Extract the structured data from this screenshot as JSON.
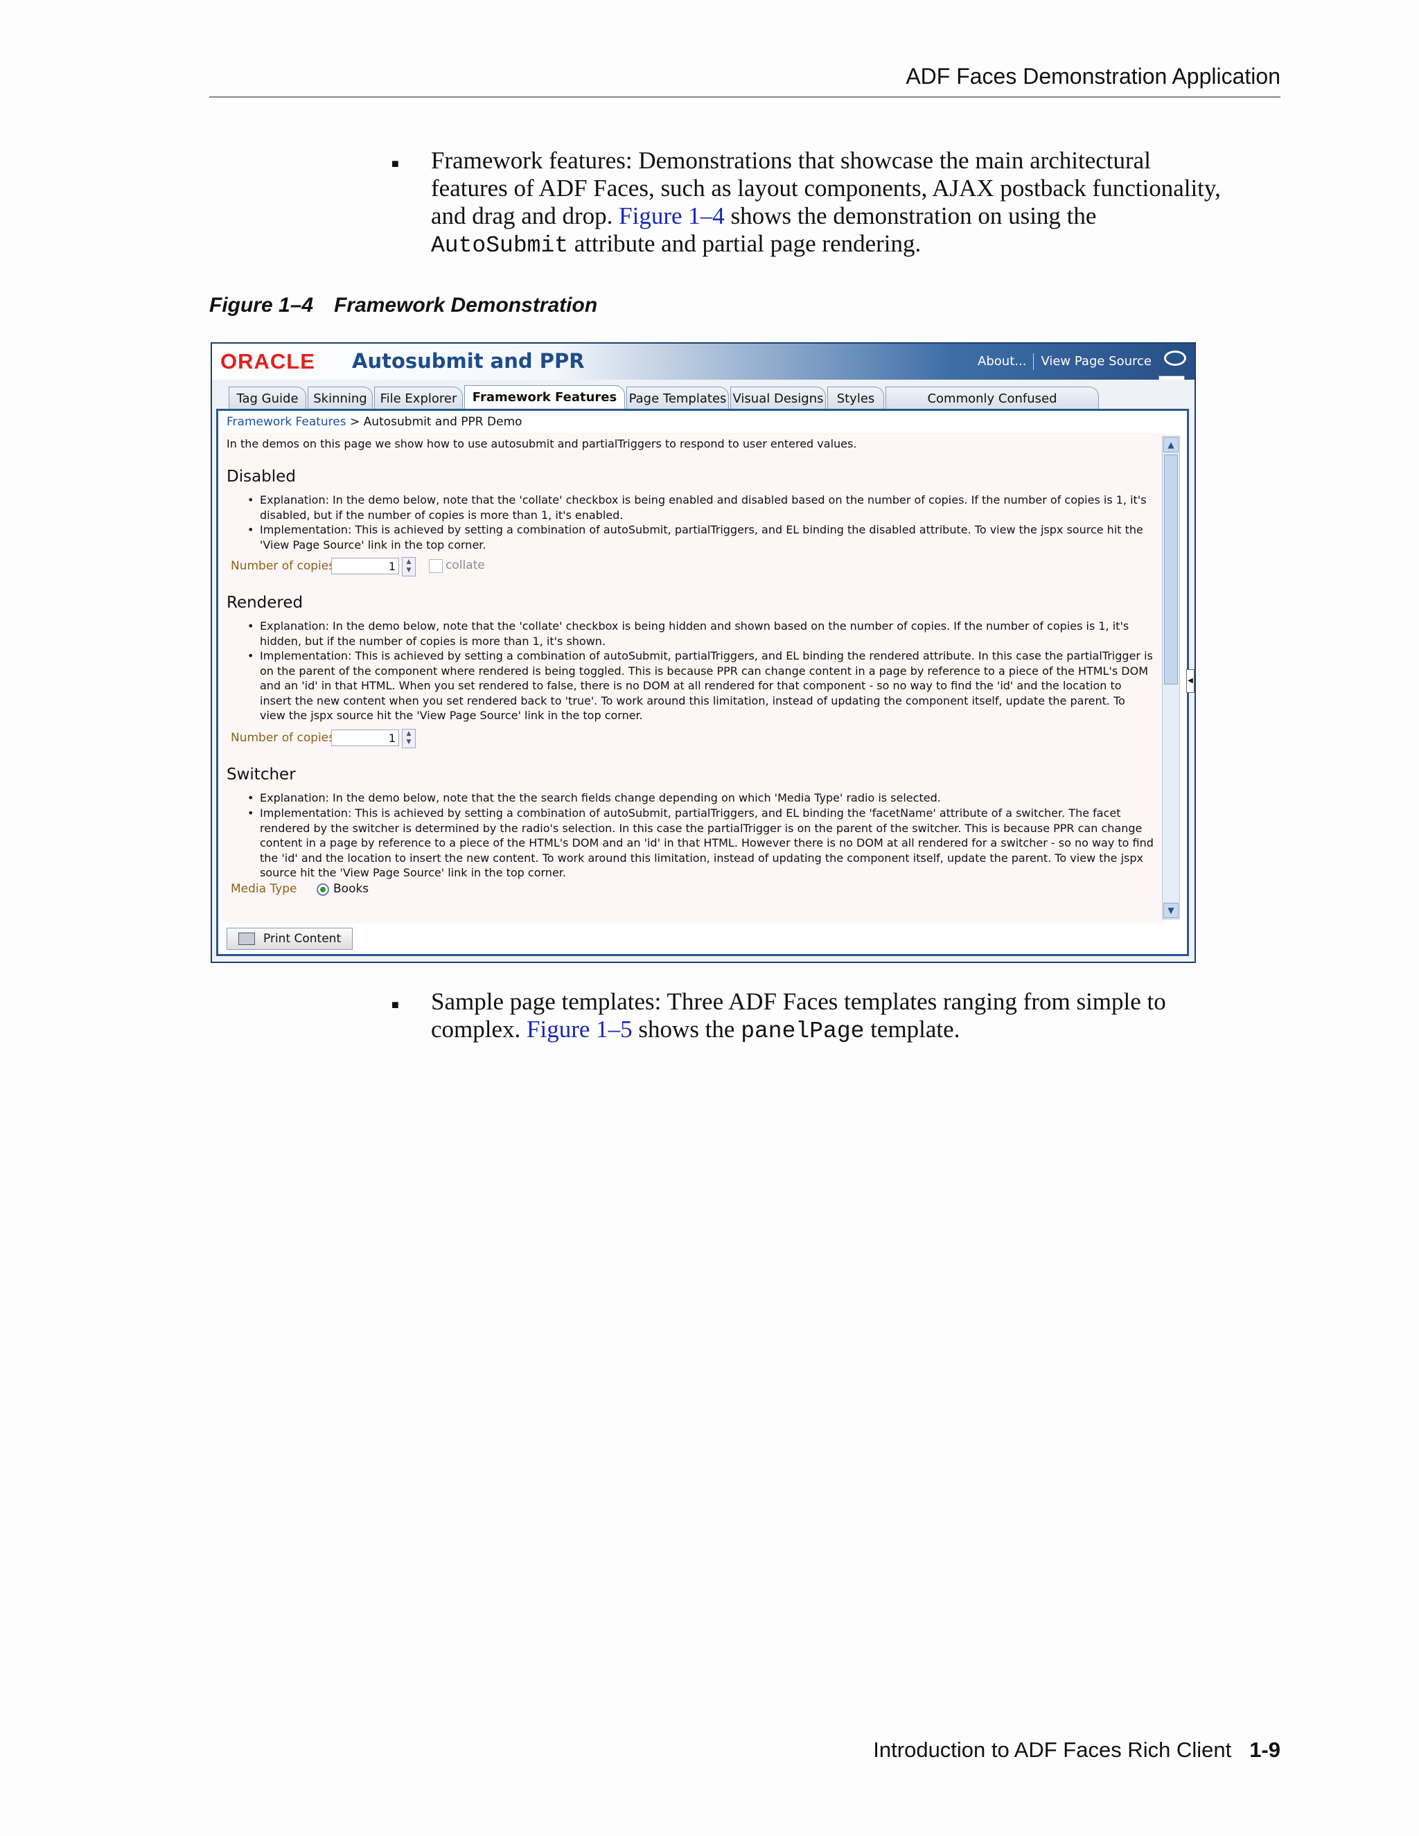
{
  "header": {
    "running_title": "ADF Faces Demonstration Application"
  },
  "items": [
    {
      "line1": "Framework features: Demonstrations that showcase the main architectural",
      "line2": "features of ADF Faces, such as layout components, AJAX postback functionality,",
      "line3_pre": "and drag and drop. ",
      "line3_link": "Figure 1–4",
      "line3_post": " shows the demonstration on using the",
      "line4_code": "AutoSubmit",
      "line4_post": " attribute and partial page rendering."
    },
    {
      "line1": "Sample page templates: Three ADF Faces templates ranging from simple to",
      "line2_pre": "complex. ",
      "line2_link": "Figure 1–5",
      "line2_mid": " shows the ",
      "line2_code": "panelPage",
      "line2_post": " template."
    }
  ],
  "figure": {
    "number": "Figure 1–4",
    "title": "Framework Demonstration"
  },
  "screenshot": {
    "logo": "ORACLE",
    "title": "Autosubmit and PPR",
    "links": [
      "About...",
      "View Page Source"
    ],
    "tabs": [
      "Tag Guide",
      "Skinning",
      "File Explorer",
      "Framework Features",
      "Page Templates",
      "Visual Designs",
      "Styles",
      "Commonly Confused Components"
    ],
    "active_tab": "Framework Features",
    "breadcrumb": {
      "link": "Framework Features",
      "sep": " > ",
      "current": "Autosubmit and PPR Demo"
    },
    "intro": "In the demos on this page we show how to use autosubmit and partialTriggers to respond to user entered values.",
    "sections": [
      {
        "heading": "Disabled",
        "bullets": [
          "Explanation: In the demo below, note that the 'collate' checkbox is being enabled and disabled based on the number of copies. If the number of copies is 1, it's disabled, but if the number of copies is more than 1, it's enabled.",
          "Implementation: This is achieved by setting a combination of autoSubmit, partialTriggers, and EL binding the disabled attribute. To view the jspx source hit the 'View Page Source' link in the top corner."
        ],
        "field_label": "Number of copies",
        "field_value": "1",
        "checkbox_label": "collate"
      },
      {
        "heading": "Rendered",
        "bullets": [
          "Explanation: In the demo below, note that the 'collate' checkbox is being hidden and shown based on the number of copies. If the number of copies is 1, it's hidden, but if the number of copies is more than 1, it's shown.",
          "Implementation: This is achieved by setting a combination of autoSubmit, partialTriggers, and EL binding the rendered attribute. In this case the partialTrigger is on the parent of the component where rendered is being toggled. This is because PPR can change content in a page by reference to a piece of the HTML's DOM and an 'id' in that HTML. When you set rendered to false, there is no DOM at all rendered for that component - so no way to find the 'id' and the location to insert the new content when you set rendered back to 'true'. To work around this limitation, instead of updating the component itself, update the parent. To view the jspx source hit the 'View Page Source' link in the top corner."
        ],
        "field_label": "Number of copies",
        "field_value": "1"
      },
      {
        "heading": "Switcher",
        "bullets": [
          "Explanation: In the demo below, note that the the search fields change depending on which 'Media Type' radio is selected.",
          "Implementation: This is achieved by setting a combination of autoSubmit, partialTriggers, and EL binding the 'facetName' attribute of a switcher. The facet rendered by the switcher is determined by the radio's selection. In this case the partialTrigger is on the parent of the switcher. This is because PPR can change content in a page by reference to a piece of the HTML's DOM and an 'id' in that HTML. However there is no DOM at all rendered for a switcher - so no way to find the 'id' and the location to insert the new content. To work around this limitation, instead of updating the component itself, update the parent. To view the jspx source hit the 'View Page Source' link in the top corner."
        ],
        "field_label": "Media Type",
        "radio_label": "Books"
      }
    ],
    "print_button": "Print Content"
  },
  "footer": {
    "chapter": "Introduction to ADF Faces Rich Client",
    "page": "1-9"
  }
}
